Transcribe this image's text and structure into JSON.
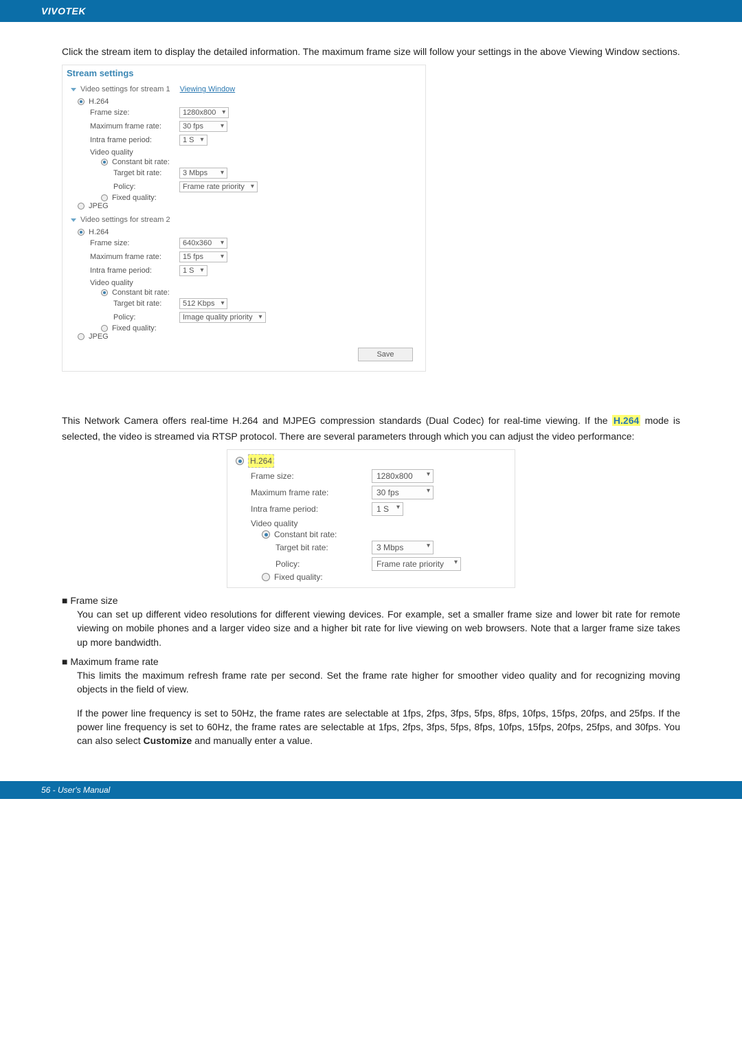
{
  "header": {
    "brand": "VIVOTEK"
  },
  "intro": "Click the stream item to display the detailed information. The maximum frame size will follow your settings in the above Viewing Window sections.",
  "panel": {
    "title": "Stream settings",
    "stream1": {
      "header": "Video settings for stream 1",
      "viewing_window": "Viewing Window",
      "codec_h264": "H.264",
      "frame_size_label": "Frame size:",
      "frame_size_value": "1280x800",
      "max_fr_label": "Maximum frame rate:",
      "max_fr_value": "30 fps",
      "intra_label": "Intra frame period:",
      "intra_value": "1 S",
      "vq_label": "Video quality",
      "cbr_label": "Constant bit rate:",
      "target_label": "Target bit rate:",
      "target_value": "3 Mbps",
      "policy_label": "Policy:",
      "policy_value": "Frame rate priority",
      "fixed_label": "Fixed quality:",
      "jpeg": "JPEG"
    },
    "stream2": {
      "header": "Video settings for stream 2",
      "codec_h264": "H.264",
      "frame_size_label": "Frame size:",
      "frame_size_value": "640x360",
      "max_fr_label": "Maximum frame rate:",
      "max_fr_value": "15 fps",
      "intra_label": "Intra frame period:",
      "intra_value": "1 S",
      "vq_label": "Video quality",
      "cbr_label": "Constant bit rate:",
      "target_label": "Target bit rate:",
      "target_value": "512 Kbps",
      "policy_label": "Policy:",
      "policy_value": "Image quality priority",
      "fixed_label": "Fixed quality:",
      "jpeg": "JPEG"
    },
    "save": "Save"
  },
  "mid": {
    "before_hl": "This Network Camera offers real-time H.264 and MJPEG compression standards (Dual Codec) for real-time viewing. If the ",
    "hl": "H.264",
    "after_hl": " mode is selected, the video is streamed via RTSP protocol. There are several parameters through which you can adjust the video performance:"
  },
  "detail": {
    "codec": "H.264",
    "frame_size_label": "Frame size:",
    "frame_size_value": "1280x800",
    "max_fr_label": "Maximum frame rate:",
    "max_fr_value": "30 fps",
    "intra_label": "Intra frame period:",
    "intra_value": "1 S",
    "vq_label": "Video quality",
    "cbr_label": "Constant bit rate:",
    "target_label": "Target bit rate:",
    "target_value": "3 Mbps",
    "policy_label": "Policy:",
    "policy_value": "Frame rate priority",
    "fixed_label": "Fixed quality:"
  },
  "bullets": {
    "frame_size_hd": "■ Frame size",
    "frame_size_txt": "You can set up different video resolutions for different viewing devices. For example, set a smaller frame size and lower bit rate for remote viewing on mobile phones and a larger video size and a higher bit rate for live viewing on web browsers. Note that a larger frame size takes up more bandwidth.",
    "max_fr_hd": "■ Maximum frame rate",
    "max_fr_txt": "This limits the maximum refresh frame rate per second. Set the frame rate higher for smoother video quality and for recognizing moving objects in the field of view.",
    "max_fr_txt2_a": "If the power line frequency is set to 50Hz, the frame rates are selectable at 1fps, 2fps, 3fps, 5fps, 8fps, 10fps, 15fps, 20fps, and 25fps. If the power line frequency is set to 60Hz, the frame rates are selectable at 1fps, 2fps, 3fps, 5fps, 8fps, 10fps, 15fps, 20fps, 25fps, and 30fps. You can also select ",
    "customize": "Customize",
    "max_fr_txt2_b": " and manually enter a value."
  },
  "footer": {
    "page": "56 - User's Manual"
  }
}
